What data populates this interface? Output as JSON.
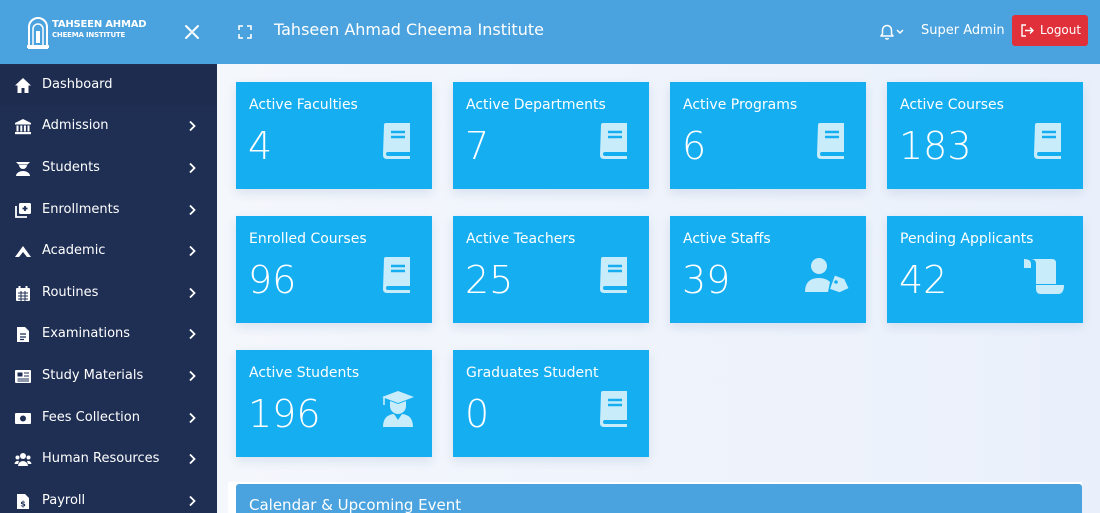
{
  "brand": {
    "line1": "TAHSEEN AHMAD",
    "line2": "CHEEMA INSTITUTE"
  },
  "header": {
    "title": "Tahseen Ahmad Cheema Institute",
    "user": "Super Admin",
    "logout_label": "Logout"
  },
  "colors": {
    "topbar": "#4aa3df",
    "sidebar": "#1f2f54",
    "card": "#15aef1",
    "logout": "#e0303a"
  },
  "sidebar": {
    "items": [
      {
        "label": "Dashboard",
        "icon": "home-icon",
        "has_submenu": false
      },
      {
        "label": "Admission",
        "icon": "university-icon",
        "has_submenu": true
      },
      {
        "label": "Students",
        "icon": "student-icon",
        "has_submenu": true
      },
      {
        "label": "Enrollments",
        "icon": "enroll-icon",
        "has_submenu": true
      },
      {
        "label": "Academic",
        "icon": "academic-icon",
        "has_submenu": true
      },
      {
        "label": "Routines",
        "icon": "calendar-icon",
        "has_submenu": true
      },
      {
        "label": "Examinations",
        "icon": "file-icon",
        "has_submenu": true
      },
      {
        "label": "Study Materials",
        "icon": "newspaper-icon",
        "has_submenu": true
      },
      {
        "label": "Fees Collection",
        "icon": "money-icon",
        "has_submenu": true
      },
      {
        "label": "Human Resources",
        "icon": "users-icon",
        "has_submenu": true
      },
      {
        "label": "Payroll",
        "icon": "payroll-icon",
        "has_submenu": true
      }
    ]
  },
  "stats": [
    {
      "title": "Active Faculties",
      "value": "4",
      "icon": "book-icon"
    },
    {
      "title": "Active Departments",
      "value": "7",
      "icon": "book-icon"
    },
    {
      "title": "Active Programs",
      "value": "6",
      "icon": "book-icon"
    },
    {
      "title": "Active Courses",
      "value": "183",
      "icon": "book-icon"
    },
    {
      "title": "Enrolled Courses",
      "value": "96",
      "icon": "book-icon"
    },
    {
      "title": "Active Teachers",
      "value": "25",
      "icon": "book-icon"
    },
    {
      "title": "Active Staffs",
      "value": "39",
      "icon": "user-tag-icon"
    },
    {
      "title": "Pending Applicants",
      "value": "42",
      "icon": "scroll-icon"
    },
    {
      "title": "Active Students",
      "value": "196",
      "icon": "graduate-icon"
    },
    {
      "title": "Graduates Student",
      "value": "0",
      "icon": "book-icon"
    }
  ],
  "calendar": {
    "title": "Calendar & Upcoming Event"
  }
}
